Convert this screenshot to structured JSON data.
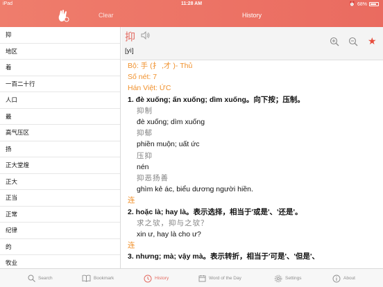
{
  "status_bar": {
    "device": "iPad",
    "time": "11:28 AM",
    "battery": "68%"
  },
  "header": {
    "clear_label": "Clear",
    "title": "History"
  },
  "history": [
    "抑",
    "地区",
    "着",
    "一百二十行",
    "人口",
    "最",
    "高气压区",
    "扬",
    "正大堂煌",
    "正大",
    "正当",
    "正常",
    "纪律",
    "的",
    "牧业"
  ],
  "entry": {
    "word": "抑",
    "pinyin": "[yì]",
    "radical": "Bộ: 手 (扌 ,才 )- Thủ",
    "strokes": "Số nét: 7",
    "hanviet": "Hán Việt: ỨC",
    "lines": [
      {
        "style": "bold",
        "text": "1. đè xuống; ấn xuống; dìm xuống。向下按；压制。"
      },
      {
        "style": "gray",
        "text": "抑制"
      },
      {
        "style": "plain",
        "text": "đè xuống; dìm xuống"
      },
      {
        "style": "gray",
        "text": "抑郁"
      },
      {
        "style": "plain",
        "text": "phiền muộn; uất ức"
      },
      {
        "style": "gray",
        "text": "压抑"
      },
      {
        "style": "plain",
        "text": "nén"
      },
      {
        "style": "gray",
        "text": "抑恶扬善"
      },
      {
        "style": "plain",
        "text": "ghìm kẻ ác, biểu dương người hiền."
      },
      {
        "style": "orange",
        "text": "连"
      },
      {
        "style": "bold",
        "text": "2. hoặc là; hay là。表示选择，相当于'或是'、'还是'。"
      },
      {
        "style": "gray",
        "text": "求之欤，抑与之欤？"
      },
      {
        "style": "plain",
        "text": "xin ư, hay là cho ư?"
      },
      {
        "style": "orange",
        "text": "连"
      },
      {
        "style": "bold",
        "text": "3. nhưng; mà; vậy mà。表示转折，相当于'可是'、'但是'、"
      }
    ]
  },
  "tabs": [
    {
      "label": "Search",
      "icon": "search-icon"
    },
    {
      "label": "Bookmark",
      "icon": "book-icon"
    },
    {
      "label": "History",
      "icon": "clock-icon",
      "active": true
    },
    {
      "label": "Word of the Day",
      "icon": "calendar-icon"
    },
    {
      "label": "Settings",
      "icon": "gear-icon"
    },
    {
      "label": "About",
      "icon": "info-icon"
    }
  ],
  "colors": {
    "accent": "#e36b62",
    "header": "#ec7466",
    "orange": "#f0902b",
    "star": "#e74c3c"
  }
}
